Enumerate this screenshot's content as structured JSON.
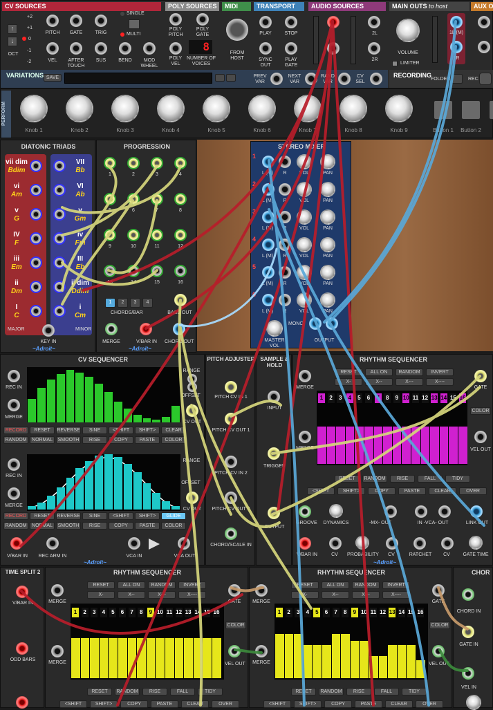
{
  "top": {
    "cv_sources": "CV SOURCES",
    "poly_sources": "POLY SOURCES",
    "midi": "MIDI",
    "transport": "TRANSPORT",
    "audio_sources": "AUDIO SOURCES",
    "main_outs": "MAIN OUTS",
    "main_outs_sub": "to host",
    "aux_out": "AUX OU",
    "oct_values": [
      "+2",
      "+1",
      "0",
      "-1",
      "-2"
    ],
    "oct": "OCT",
    "cv_labels_row1": [
      "PITCH",
      "GATE",
      "TRIG"
    ],
    "cv_labels_row2": [
      "VEL",
      "AFTER TOUCH",
      "SUS",
      "BEND",
      "MOD WHEEL"
    ],
    "single": "SINGLE",
    "multi": "MULTI",
    "poly_labels": [
      "POLY PITCH",
      "POLY GATE",
      "POLY VEL",
      "NUMBER OF VOICES"
    ],
    "voices": "8",
    "from_host": "FROM HOST",
    "transport_labels": [
      "PLAY",
      "STOP",
      "SYNC OUT",
      "PLAY GATE"
    ],
    "audio_labels": [
      "1L",
      "1R",
      "2L",
      "2R"
    ],
    "main_labels": [
      "1L (M)",
      "1R"
    ],
    "volume": "VOLUME",
    "limiter": "LIMITER",
    "recording": "RECORDING",
    "folder": "FOLDER",
    "rec": "REC",
    "variations": "VARIATIONS",
    "save": "SAVE",
    "prev_var": "PREV VAR",
    "next_var": "NEXT VAR",
    "rand_var": "RAND VAR",
    "cv_sel": "CV SEL"
  },
  "perform": {
    "label": "PERFORM",
    "knobs": [
      "Knob 1",
      "Knob 2",
      "Knob 3",
      "Knob 4",
      "Knob 5",
      "Knob 6",
      "Knob 7",
      "Knob 8",
      "Knob 9"
    ],
    "buttons": [
      "Button 1",
      "Button 2",
      "Butt"
    ]
  },
  "diatonic": {
    "title": "DIATONIC TRIADS",
    "major": [
      [
        "vii dim",
        "Bdim"
      ],
      [
        "vi",
        "Am"
      ],
      [
        "v",
        "G"
      ],
      [
        "IV",
        "F"
      ],
      [
        "iii",
        "Em"
      ],
      [
        "ii",
        "Dm"
      ],
      [
        "I",
        "C"
      ]
    ],
    "minor": [
      [
        "VII",
        "Bb"
      ],
      [
        "VI",
        "Ab"
      ],
      [
        "v",
        "Gm"
      ],
      [
        "iv",
        "Fm"
      ],
      [
        "III",
        "Eb"
      ],
      [
        "ii dim",
        "Ddim"
      ],
      [
        "i",
        "Cm"
      ]
    ],
    "major_lbl": "MAJOR",
    "minor_lbl": "MINOR",
    "key_in": "KEY IN",
    "brand": "~Adroit~"
  },
  "progression": {
    "title": "PROGRESSION",
    "steps": [
      "1",
      "2",
      "3",
      "4",
      "5",
      "6",
      "7",
      "8",
      "9",
      "10",
      "11",
      "12",
      "13",
      "14",
      "15",
      "16"
    ],
    "chords_bar": "CHORDS/BAR",
    "chord_btns": [
      "1",
      "2",
      "3",
      "4"
    ],
    "bass_out": "BASS OUT",
    "merge": "MERGE",
    "vbar_in": "V/BAR IN",
    "chord_out": "CHORD OUT",
    "brand": "~Adroit~"
  },
  "mixer": {
    "title": "STEREO MIXER",
    "channels": [
      "1",
      "2",
      "3",
      "4",
      "5",
      "6"
    ],
    "l": "L (M)",
    "r": "R",
    "vol": "VOL",
    "pan": "PAN",
    "master": "MASTER VOL",
    "mono": "MONO",
    "output": "OUTPUT"
  },
  "cvseq": {
    "title": "CV SEQUENCER",
    "rec_in": "REC IN",
    "merge": "MERGE",
    "range": "RANGE",
    "offset": "OFFSET",
    "cv_out": "CV OUT",
    "btns1": [
      "RECORD",
      "RESET",
      "REVERSE",
      "SINE",
      "<SHIFT",
      "SHIFT>",
      "CLEAR"
    ],
    "btns2": [
      "RANDOM",
      "NORMAL",
      "SMOOTH",
      "RISE",
      "COPY",
      "PASTE",
      "COLOR"
    ],
    "btns3": [
      "RECORD",
      "RESET",
      "REVERSE",
      "SINE",
      "<SHIFT",
      "SHIFT>",
      "GLIDE"
    ],
    "btns4": [
      "RANDOM",
      "NORMAL",
      "SMOOTH",
      "RISE",
      "COPY",
      "PASTE",
      "COLOR"
    ],
    "green_values": [
      0.42,
      0.62,
      0.78,
      0.88,
      0.95,
      0.9,
      0.82,
      0.7,
      0.55,
      0.38,
      0.25,
      0.14,
      0.08,
      0.05,
      0.1,
      0.3
    ],
    "cyan_values": [
      0.06,
      0.13,
      0.25,
      0.4,
      0.58,
      0.75,
      0.88,
      0.97,
      1.0,
      0.95,
      0.83,
      0.67,
      0.48,
      0.3,
      0.15,
      0.06
    ],
    "vbar_in": "V/BAR IN",
    "rec_arm": "REC ARM IN",
    "vca_in": "VCA IN",
    "vca_out": "VCA OUT",
    "brand": "~Adroit~"
  },
  "pitch": {
    "title": "PITCH ADJUSTER",
    "in1": "PITCH CV IN 1",
    "out1": "PITCH CV OUT 1",
    "in2": "PITCH CV IN 2",
    "out2": "PITCH CV OUT 2",
    "chord": "CHORD/SCALE IN"
  },
  "sh": {
    "title": "SAMPLE & HOLD",
    "input": "INPUT",
    "trigger": "TRIGGER",
    "output": "OUTPUT"
  },
  "rhythm1": {
    "title": "RHYTHM SEQUENCER",
    "btns1": [
      "RESET",
      "ALL ON",
      "RANDOM",
      "INVERT"
    ],
    "btns2": [
      "X-",
      "X--",
      "X---",
      "X----"
    ],
    "steps": [
      "1",
      "2",
      "3",
      "4",
      "5",
      "6",
      "7",
      "8",
      "9",
      "10",
      "11",
      "12",
      "13",
      "14",
      "15",
      "16"
    ],
    "active": [
      1,
      4,
      7,
      10,
      13,
      14,
      16
    ],
    "gate": "GATE",
    "color": "COLOR",
    "vel_out": "VEL OUT",
    "merge": "MERGE",
    "btns3": [
      "RESET",
      "RANDOM",
      "RISE",
      "FALL",
      "TIDY"
    ],
    "btns4": [
      "<SHIFT",
      "SHIFT>",
      "COPY",
      "PASTE",
      "CLEAR",
      "OVER"
    ],
    "groove": "GROOVE",
    "dynamics": "DYNAMICS",
    "mx": "-MX- OUT",
    "vca": "IN -VCA- OUT",
    "link": "LINK OUT",
    "vbar": "V/BAR IN",
    "cv": "CV",
    "prob": "PROBABILITY",
    "ratchet": "RATCHET",
    "gate_time": "GATE TIME",
    "brand": "~Adroit~"
  },
  "bottom": {
    "time_split": "TIME SPLIT 2",
    "vbar_in": "V/BAR IN",
    "odd_bars": "ODD BARS",
    "rs2": "RHYTHM SEQUENCER",
    "rs3": "RHYTHM SEQUENCER",
    "chord": "CHOR",
    "chord_in": "CHORD IN",
    "gate_in": "GATE IN",
    "vel_in": "VEL IN",
    "btns1": [
      "RESET",
      "ALL ON",
      "RANDOM",
      "INVERT"
    ],
    "btns2": [
      "X-",
      "X--",
      "X---",
      "X----"
    ],
    "btns3": [
      "RESET",
      "RANDOM",
      "RISE",
      "FALL",
      "TIDY"
    ],
    "btns4": [
      "<SHIFT",
      "SHIFT>",
      "COPY",
      "PASTE",
      "CLEAR",
      "OVER"
    ],
    "merge": "MERGE",
    "gate": "GATE",
    "color": "COLOR",
    "vel_out": "VEL OUT",
    "rs2_levels": [
      0.9,
      0.9,
      0.9,
      0.9,
      0.9,
      0.9,
      0.9,
      0.9,
      0.9,
      0.9,
      0.9,
      0.9,
      0.9,
      0.9,
      0.9,
      0.9
    ],
    "rs3_levels": [
      1.0,
      1.0,
      1.0,
      0.75,
      0.75,
      0.75,
      1.0,
      1.0,
      0.85,
      0.85,
      0.5,
      0.5,
      0.75,
      0.75,
      0.75,
      0.4
    ]
  }
}
